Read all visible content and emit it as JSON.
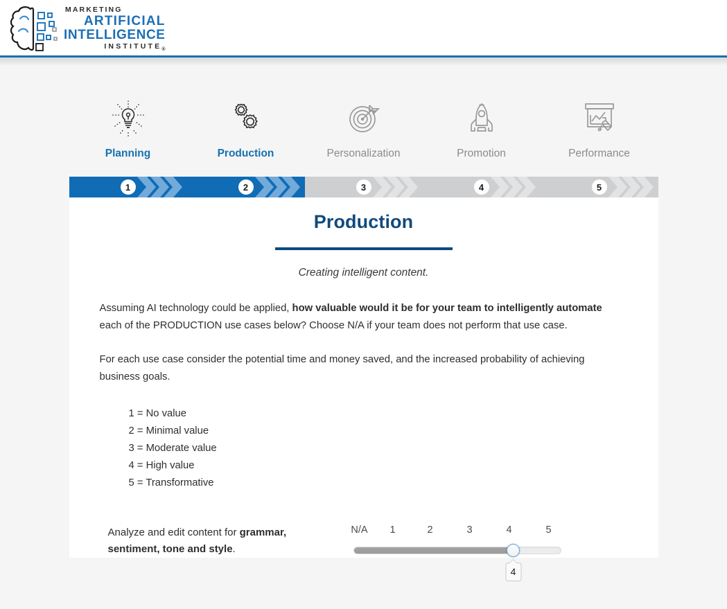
{
  "header": {
    "logo": {
      "line1": "MARKETING",
      "line2": "ARTIFICIAL",
      "line3": "INTELLIGENCE",
      "line4": "INSTITUTE",
      "registered": "®",
      "brand_blue": "#1b6fb5",
      "brand_dark": "#2b2b2b"
    },
    "accent_color": "#1570b0"
  },
  "steps_nav": [
    {
      "label": "Planning",
      "icon": "lightbulb-icon",
      "active": true
    },
    {
      "label": "Production",
      "icon": "gears-icon",
      "active": true
    },
    {
      "label": "Personalization",
      "icon": "target-icon",
      "active": false
    },
    {
      "label": "Promotion",
      "icon": "rocket-icon",
      "active": false
    },
    {
      "label": "Performance",
      "icon": "chart-board-icon",
      "active": false
    }
  ],
  "progress": {
    "current_step": 2,
    "total_steps": 5,
    "active_color": "#0f6cb5",
    "active_chevron_color": "#72aada",
    "inactive_color": "#cdcfd1",
    "inactive_chevron_color": "#e2e3e4",
    "segments": [
      {
        "number": "1",
        "active": true
      },
      {
        "number": "2",
        "active": true
      },
      {
        "number": "3",
        "active": false
      },
      {
        "number": "4",
        "active": false
      },
      {
        "number": "5",
        "active": false
      }
    ]
  },
  "section": {
    "title": "Production",
    "title_color": "#114a7b",
    "subtitle": "Creating intelligent content.",
    "paragraph1": {
      "pre": "Assuming AI technology could be applied, ",
      "bold": "how valuable would it be for your team to intelligently automate",
      "post": " each of the PRODUCTION use cases below? Choose N/A if your team does not perform that use case."
    },
    "paragraph2": "For each use case consider the potential time and money saved, and the increased probability of achieving business goals.",
    "scale": [
      "1 = No value",
      "2 = Minimal value",
      "3 = Moderate value",
      "4 = High value",
      "5 = Transformative"
    ]
  },
  "question": {
    "text_pre": "Analyze and edit content for ",
    "text_bold": "grammar, sentiment, tone and style",
    "text_post": ".",
    "tick_labels": [
      "N/A",
      "1",
      "2",
      "3",
      "4",
      "5"
    ],
    "selected_value": "4",
    "selected_index": 4,
    "thumb_border_color": "#5fa3e0"
  }
}
